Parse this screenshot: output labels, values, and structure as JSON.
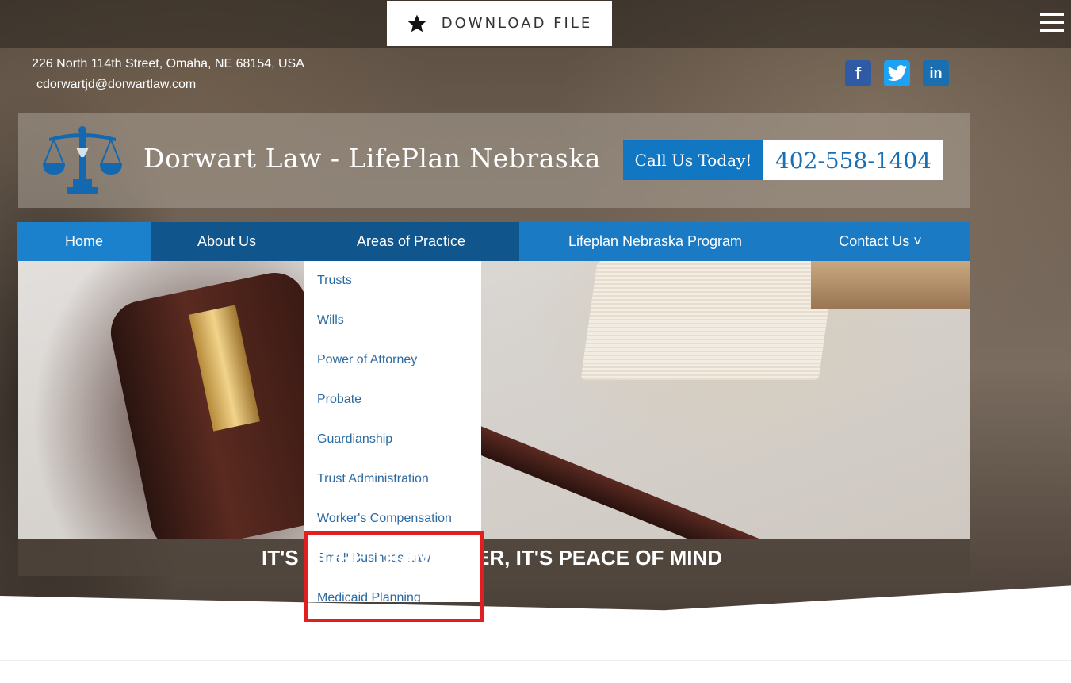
{
  "topbar": {
    "download_label": "DOWNLOAD FILE"
  },
  "contact": {
    "address": "226 North 114th Street, Omaha, NE 68154, USA",
    "email": "cdorwartjd@dorwartlaw.com"
  },
  "socials": [
    {
      "name": "facebook-icon",
      "glyph": "f"
    },
    {
      "name": "twitter-icon",
      "glyph": "t"
    },
    {
      "name": "linkedin-icon",
      "glyph": "in"
    }
  ],
  "header": {
    "brand_title": "Dorwart Law - LifePlan Nebraska",
    "call_label": "Call Us Today!",
    "phone": "402-558-1404"
  },
  "nav": {
    "items": [
      {
        "label": "Home"
      },
      {
        "label": "About Us"
      },
      {
        "label": "Areas of Practice"
      },
      {
        "label": "Lifeplan Nebraska Program"
      },
      {
        "label": "Contact Us ˅"
      }
    ]
  },
  "dropdown": {
    "items": [
      {
        "label": "Trusts"
      },
      {
        "label": "Wills"
      },
      {
        "label": "Power of Attorney"
      },
      {
        "label": "Probate"
      },
      {
        "label": "Guardianship"
      },
      {
        "label": "Trust Administration"
      },
      {
        "label": "Worker's Compensation"
      },
      {
        "label": "Small Business Law"
      },
      {
        "label": "Medicaid Planning"
      }
    ]
  },
  "hero": {
    "tagline": "IT'S MORE THAN PAPER, IT'S PEACE OF MIND"
  },
  "colors": {
    "brand_blue": "#1a7ac4",
    "nav_active": "#11558d",
    "link_blue": "#2c6aa2",
    "highlight_red": "#e02020"
  }
}
